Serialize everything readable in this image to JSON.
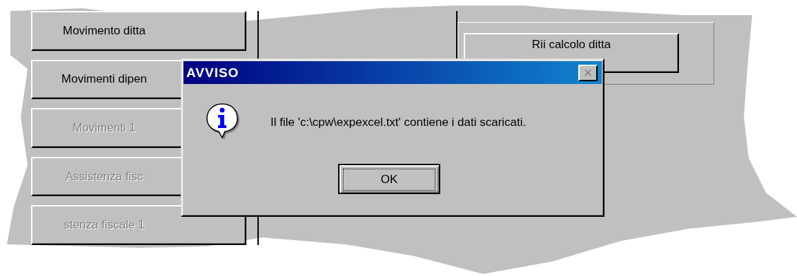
{
  "left_buttons": [
    {
      "label": "Movimento ditta",
      "disabled": false
    },
    {
      "label": "Movimenti dipen",
      "disabled": false
    },
    {
      "label": "Movimenti 1",
      "disabled": true
    },
    {
      "label": "Assistenza fisc",
      "disabled": true
    },
    {
      "label": "stenza fiscale 1",
      "disabled": true
    }
  ],
  "right_button": {
    "label": "Rii calcolo ditta",
    "disabled": false
  },
  "dialog": {
    "title": "AVVISO",
    "close": "×",
    "message": "Il file 'c:\\cpw\\expexcel.txt' contiene i dati scaricati.",
    "button": "OK"
  }
}
